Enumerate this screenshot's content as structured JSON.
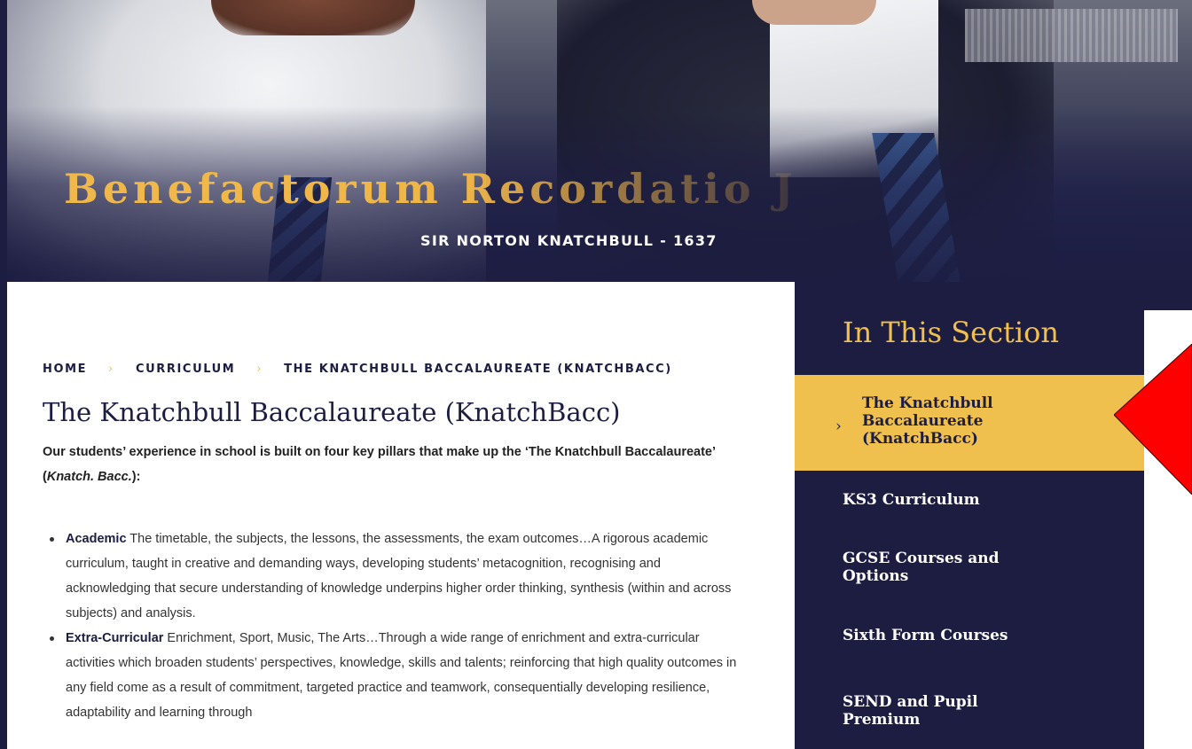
{
  "hero": {
    "motto": "Benefactorum Recordatio Ju",
    "author": "SIR NORTON KNATCHBULL - 1637"
  },
  "breadcrumb": {
    "home": "HOME",
    "section": "CURRICULUM",
    "current": "THE KNATCHBULL BACCALAUREATE (KNATCHBACC)",
    "separator": "›"
  },
  "page": {
    "title": "The Knatchbull Baccalaureate (KnatchBacc)",
    "intro_before": "Our students’ experience in school is built on four key pillars that make up the ‘The Knatchbull Baccalaureate’ (",
    "intro_em": "Knatch. Bacc.",
    "intro_after": "):",
    "pillars": [
      {
        "term": "Academic",
        "text": " The timetable, the subjects, the lessons, the assessments, the exam outcomes…A rigorous academic curriculum, taught in creative and demanding ways, developing students’ metacognition, recognising and acknowledging that secure understanding of knowledge underpins higher order thinking, synthesis (within and across subjects) and analysis."
      },
      {
        "term": "Extra-Curricular",
        "text": " Enrichment, Sport, Music, The Arts…Through a wide range of enrichment and extra-curricular activities which broaden students’ perspectives, knowledge, skills and talents; reinforcing that high quality outcomes in any field come as a result of commitment, targeted practice and teamwork, consequentially developing resilience, adaptability and learning through"
      }
    ]
  },
  "sidebar": {
    "title": "In This Section",
    "active_chevron": "›",
    "items": [
      {
        "label": "The Knatchbull Baccalaureate (KnatchBacc)"
      },
      {
        "label": "KS3 Curriculum"
      },
      {
        "label": "GCSE Courses and Options"
      },
      {
        "label": "Sixth Form Courses"
      },
      {
        "label": "SEND and Pupil Premium"
      }
    ]
  },
  "colors": {
    "navy": "#1d1d42",
    "gold": "#f0c04f",
    "arrow_red": "#ff0000"
  }
}
